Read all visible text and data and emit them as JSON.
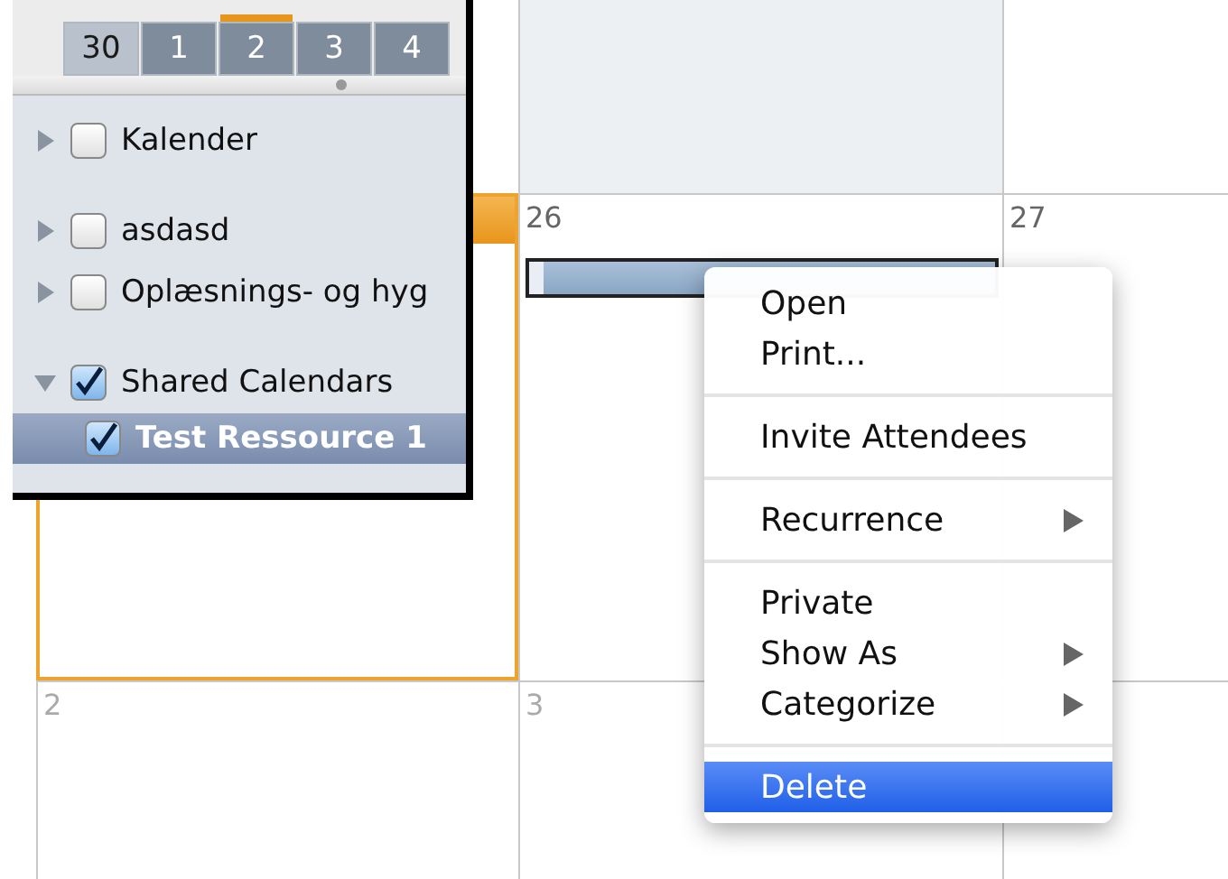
{
  "calendar": {
    "cells": [
      {},
      {
        "shaded": true
      },
      {},
      {
        "today": true
      },
      {
        "day": "26"
      },
      {
        "day": "27"
      },
      {
        "day": "2"
      },
      {
        "day": "3"
      },
      {}
    ],
    "event": {
      "kind": "event"
    }
  },
  "mini_calendar": {
    "days": [
      {
        "label": "30",
        "selected": false,
        "kind": "dark"
      },
      {
        "label": "1",
        "selected": false,
        "kind": "light"
      },
      {
        "label": "2",
        "selected": true,
        "kind": "light"
      },
      {
        "label": "3",
        "selected": false,
        "kind": "light"
      },
      {
        "label": "4",
        "selected": false,
        "kind": "light"
      }
    ]
  },
  "sidebar": {
    "groups": [
      {
        "items": [
          {
            "label": "Kalender",
            "checked": false,
            "expanded": false,
            "selected": false
          }
        ]
      },
      {
        "items": [
          {
            "label": "asdasd",
            "checked": false,
            "expanded": false,
            "selected": false
          },
          {
            "label": "Oplæsnings- og hyg",
            "checked": false,
            "expanded": false,
            "selected": false
          }
        ]
      },
      {
        "items": [
          {
            "label": "Shared Calendars",
            "checked": true,
            "expanded": true,
            "selected": false,
            "children": [
              {
                "label": "Test Ressource 1",
                "checked": true,
                "selected": true
              }
            ]
          }
        ]
      }
    ]
  },
  "context_menu": {
    "groups": [
      [
        {
          "label": "Open",
          "submenu": false,
          "selected": false
        },
        {
          "label": "Print...",
          "submenu": false,
          "selected": false
        }
      ],
      [
        {
          "label": "Invite Attendees",
          "submenu": false,
          "selected": false
        }
      ],
      [
        {
          "label": "Recurrence",
          "submenu": true,
          "selected": false
        }
      ],
      [
        {
          "label": "Private",
          "submenu": false,
          "selected": false
        },
        {
          "label": "Show As",
          "submenu": true,
          "selected": false
        },
        {
          "label": "Categorize",
          "submenu": true,
          "selected": false
        }
      ],
      [
        {
          "label": "Delete",
          "submenu": false,
          "selected": true
        }
      ]
    ]
  }
}
